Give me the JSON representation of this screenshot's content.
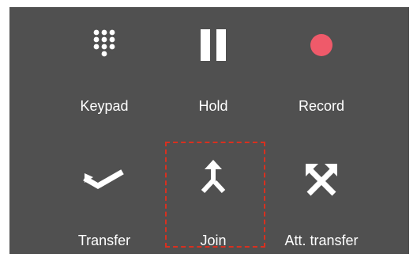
{
  "call_controls": {
    "keypad": {
      "label": "Keypad",
      "icon": "keypad-icon"
    },
    "hold": {
      "label": "Hold",
      "icon": "pause-icon"
    },
    "record": {
      "label": "Record",
      "icon": "record-dot-icon",
      "icon_color": "#ef5a6a"
    },
    "transfer": {
      "label": "Transfer",
      "icon": "transfer-check-icon"
    },
    "join": {
      "label": "Join",
      "icon": "merge-arrow-icon",
      "highlighted": true
    },
    "att_transfer": {
      "label": "Att. transfer",
      "icon": "attended-transfer-icon"
    }
  },
  "colors": {
    "panel_background": "#505050",
    "label_text": "#ffffff",
    "highlight_border": "#d9301f"
  }
}
